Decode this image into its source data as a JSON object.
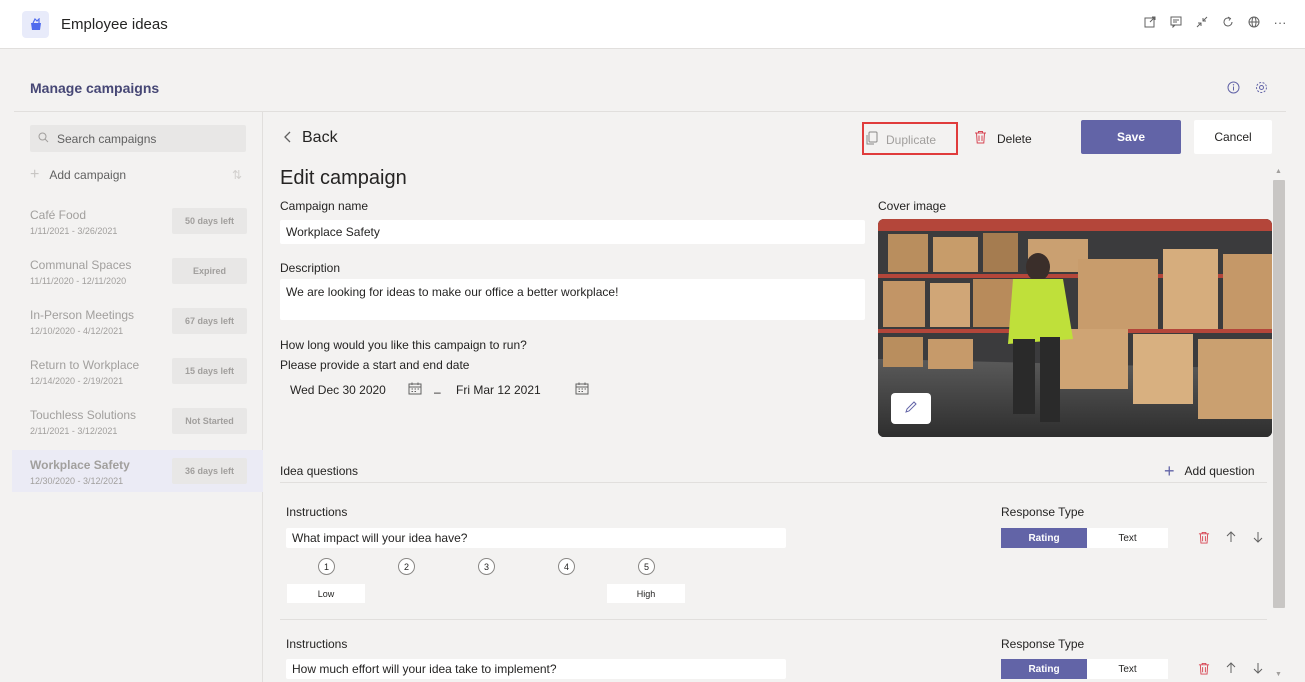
{
  "app": {
    "title": "Employee ideas"
  },
  "page": {
    "title": "Manage campaigns"
  },
  "sidebar": {
    "search_placeholder": "Search campaigns",
    "add_label": "Add campaign",
    "campaigns": [
      {
        "name": "Café Food",
        "dates": "1/11/2021 - 3/26/2021",
        "status": "50 days left"
      },
      {
        "name": "Communal Spaces",
        "dates": "11/11/2020 - 12/11/2020",
        "status": "Expired"
      },
      {
        "name": "In-Person Meetings",
        "dates": "12/10/2020 - 4/12/2021",
        "status": "67 days left"
      },
      {
        "name": "Return to Workplace",
        "dates": "12/14/2020 - 2/19/2021",
        "status": "15 days left"
      },
      {
        "name": "Touchless Solutions",
        "dates": "2/11/2021 - 3/12/2021",
        "status": "Not Started"
      },
      {
        "name": "Workplace Safety",
        "dates": "12/30/2020 - 3/12/2021",
        "status": "36 days left"
      }
    ]
  },
  "toolbar": {
    "back_label": "Back",
    "duplicate_label": "Duplicate",
    "delete_label": "Delete",
    "save_label": "Save",
    "cancel_label": "Cancel"
  },
  "form": {
    "title": "Edit campaign",
    "campaign_name_label": "Campaign name",
    "campaign_name_value": "Workplace Safety",
    "description_label": "Description",
    "description_value": "We are looking for ideas to make our office a better workplace!",
    "duration_label": "How long would you like this campaign to run?",
    "duration_help": "Please provide a start and end date",
    "start_date": "Wed Dec 30 2020",
    "date_separator": "–",
    "end_date": "Fri Mar 12 2021",
    "cover_image_label": "Cover image"
  },
  "questions": {
    "section_label": "Idea questions",
    "add_label": "Add question",
    "items": [
      {
        "instructions_label": "Instructions",
        "text": "What impact will your idea have?",
        "response_type_label": "Response Type",
        "rating_label": "Rating",
        "text_label": "Text",
        "scale": [
          "1",
          "2",
          "3",
          "4",
          "5"
        ],
        "low_label": "Low",
        "high_label": "High"
      },
      {
        "instructions_label": "Instructions",
        "text": "How much effort will your idea take to implement?",
        "response_type_label": "Response Type",
        "rating_label": "Rating",
        "text_label": "Text"
      }
    ]
  },
  "colors": {
    "accent": "#6264a7",
    "danger": "#e03c3c",
    "delete_icon": "#d74654"
  }
}
